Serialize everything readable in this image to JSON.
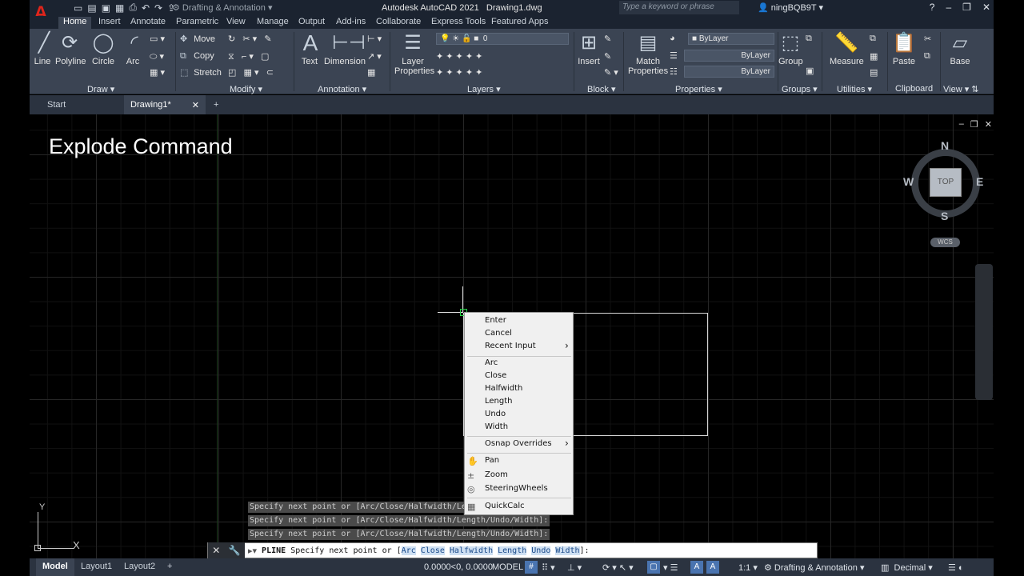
{
  "window": {
    "title": "Autodesk AutoCAD 2021",
    "filename": "Drawing1.dwg",
    "workspace": "Drafting & Annotation",
    "search_placeholder": "Type a keyword or phrase",
    "user": "ningBQB9T"
  },
  "menu_tabs": [
    "Home",
    "Insert",
    "Annotate",
    "Parametric",
    "View",
    "Manage",
    "Output",
    "Add-ins",
    "Collaborate",
    "Express Tools",
    "Featured Apps"
  ],
  "ribbon": {
    "draw": {
      "label": "Draw",
      "line": "Line",
      "polyline": "Polyline",
      "circle": "Circle",
      "arc": "Arc"
    },
    "modify": {
      "label": "Modify",
      "move": "Move",
      "copy": "Copy",
      "stretch": "Stretch"
    },
    "annotation": {
      "label": "Annotation",
      "text": "Text",
      "dimension": "Dimension"
    },
    "layers": {
      "label": "Layers",
      "layer_properties": "Layer\nProperties",
      "current_layer": "0"
    },
    "block": {
      "label": "Block",
      "insert": "Insert"
    },
    "properties": {
      "label": "Properties",
      "match": "Match\nProperties",
      "color": "ByLayer",
      "linetype": "ByLayer",
      "lineweight": "ByLayer"
    },
    "groups": {
      "label": "Groups",
      "group": "Group"
    },
    "utilities": {
      "label": "Utilities",
      "measure": "Measure"
    },
    "clipboard": {
      "label": "Clipboard",
      "paste": "Paste"
    },
    "view": {
      "label": "View",
      "base": "Base"
    }
  },
  "file_tabs": {
    "start": "Start",
    "drawing": "Drawing1*"
  },
  "overlay_title": "Explode Command",
  "viewcube": {
    "n": "N",
    "s": "S",
    "e": "E",
    "w": "W",
    "top": "TOP",
    "wcs": "WCS"
  },
  "context_menu": {
    "group1": [
      "Enter",
      "Cancel",
      "Recent Input"
    ],
    "group2": [
      "Arc",
      "Close",
      "Halfwidth",
      "Length",
      "Undo",
      "Width"
    ],
    "group3": [
      "Osnap Overrides"
    ],
    "group4": [
      "Pan",
      "Zoom",
      "SteeringWheels"
    ],
    "group5": [
      "QuickCalc"
    ]
  },
  "command_history": [
    "Specify next point or [Arc/Close/Halfwidth/Length/Undo/Width]:",
    "Specify next point or [Arc/Close/Halfwidth/Length/Undo/Width]:",
    "Specify next point or [Arc/Close/Halfwidth/Length/Undo/Width]:"
  ],
  "command_line": {
    "command": "PLINE",
    "prompt": "Specify next point or [",
    "options": [
      "Arc",
      "Close",
      "Halfwidth",
      "Length",
      "Undo",
      "Width"
    ],
    "suffix": "]:"
  },
  "ucs": {
    "x": "X",
    "y": "Y"
  },
  "status": {
    "tabs": [
      "Model",
      "Layout1",
      "Layout2"
    ],
    "coords": "0.0000<0, 0.0000",
    "mode": "MODEL",
    "scale": "1:1",
    "workspace": "Drafting & Annotation",
    "units": "Decimal"
  }
}
